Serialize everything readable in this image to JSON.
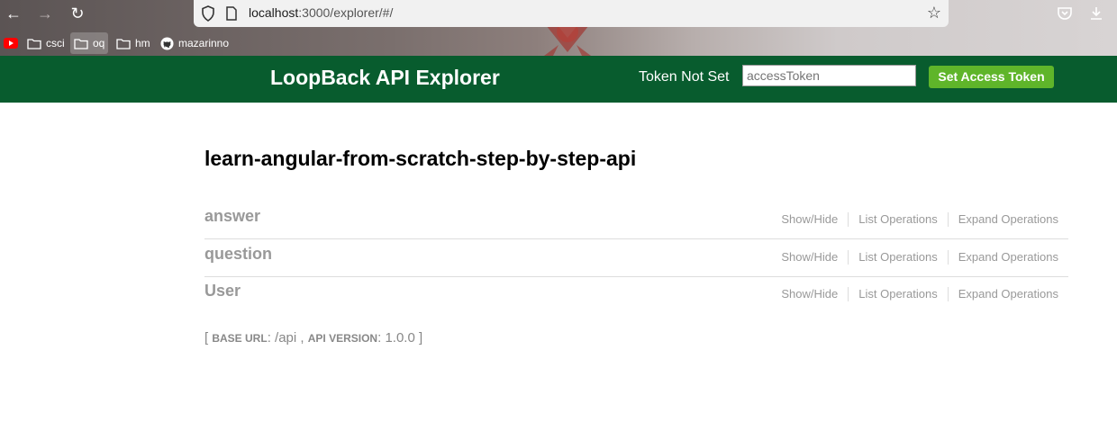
{
  "browser": {
    "url_host": "localhost",
    "url_path": ":3000/explorer/#/",
    "bookmarks": [
      {
        "label": "",
        "icon": "youtube-icon"
      },
      {
        "label": "csci",
        "icon": "folder-icon"
      },
      {
        "label": "oq",
        "icon": "folder-icon"
      },
      {
        "label": "hm",
        "icon": "folder-icon"
      },
      {
        "label": "mazarinno",
        "icon": "github-icon"
      }
    ]
  },
  "header": {
    "title": "LoopBack API Explorer",
    "token_status": "Token Not Set",
    "token_placeholder": "accessToken",
    "set_token_label": "Set Access Token"
  },
  "main": {
    "api_title": "learn-angular-from-scratch-step-by-step-api",
    "resources": [
      {
        "name": "answer",
        "ops": [
          "Show/Hide",
          "List Operations",
          "Expand Operations"
        ]
      },
      {
        "name": "question",
        "ops": [
          "Show/Hide",
          "List Operations",
          "Expand Operations"
        ]
      },
      {
        "name": "User",
        "ops": [
          "Show/Hide",
          "List Operations",
          "Expand Operations"
        ]
      }
    ],
    "footer": {
      "open": "[",
      "base_url_label": "BASE URL",
      "base_url": "/api",
      "sep": ",",
      "version_label": "API VERSION",
      "version": "1.0.0",
      "close": "]"
    }
  },
  "colors": {
    "header_bg": "#085c2e",
    "token_button": "#5fb52a"
  }
}
